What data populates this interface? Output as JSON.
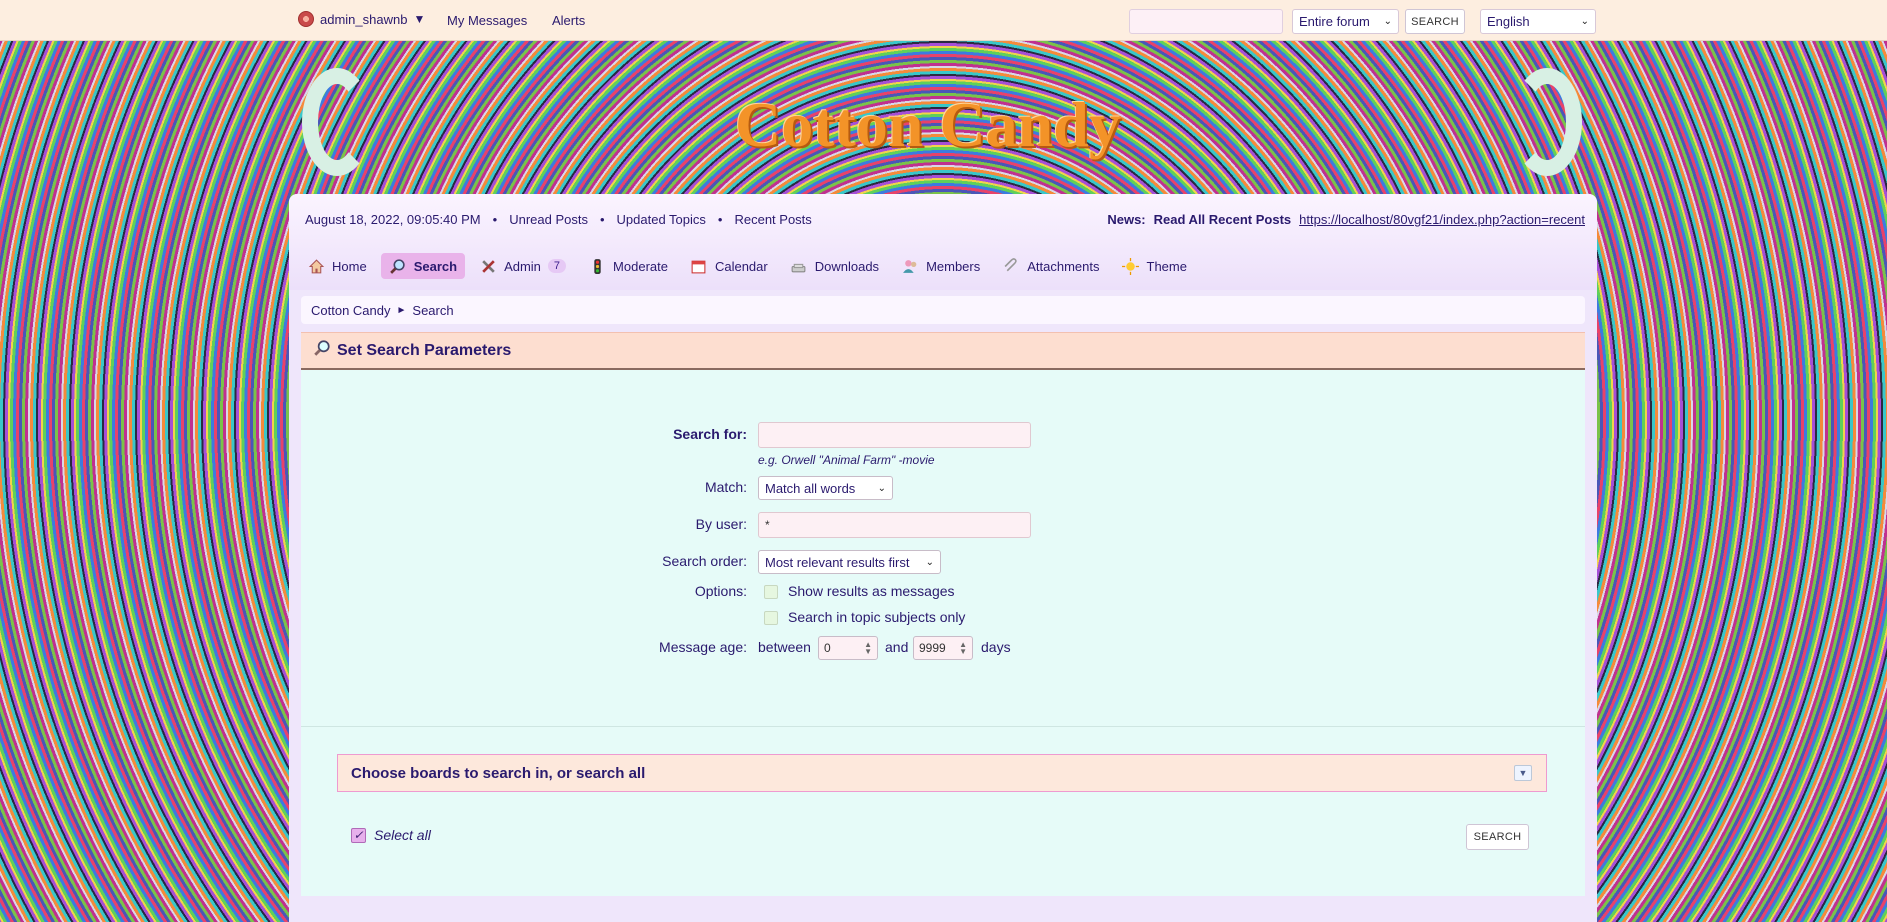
{
  "topbar": {
    "username": "admin_shawnb",
    "user_caret": "▼",
    "my_messages": "My Messages",
    "alerts": "Alerts",
    "search_placeholder": "",
    "scope_select": "Entire forum",
    "search_button": "SEARCH",
    "language_select": "English"
  },
  "banner": {
    "title": "Cotton Candy"
  },
  "infobar": {
    "datetime": "August 18, 2022, 09:05:40 PM",
    "unread": "Unread Posts",
    "updated": "Updated Topics",
    "recent": "Recent Posts",
    "sep": "•",
    "news_label": "News:",
    "news_link": "Read All Recent Posts",
    "news_url": "https://localhost/80vgf21/index.php?action=recent"
  },
  "menu": {
    "items": [
      {
        "label": "Home",
        "icon": "home-icon"
      },
      {
        "label": "Search",
        "icon": "search-icon"
      },
      {
        "label": "Admin",
        "icon": "admin-icon",
        "badge": "7"
      },
      {
        "label": "Moderate",
        "icon": "moderate-icon"
      },
      {
        "label": "Calendar",
        "icon": "calendar-icon"
      },
      {
        "label": "Downloads",
        "icon": "downloads-icon"
      },
      {
        "label": "Members",
        "icon": "members-icon"
      },
      {
        "label": "Attachments",
        "icon": "attachments-icon"
      },
      {
        "label": "Theme",
        "icon": "theme-icon"
      }
    ]
  },
  "breadcrumb": {
    "root": "Cotton Candy",
    "arrow": "►",
    "current": "Search"
  },
  "page": {
    "title": "Set Search Parameters"
  },
  "form": {
    "search_for_label": "Search for:",
    "search_for_value": "",
    "search_hint": "e.g. Orwell \"Animal Farm\" -movie",
    "match_label": "Match:",
    "match_value": "Match all words",
    "by_user_label": "By user:",
    "by_user_value": "*",
    "order_label": "Search order:",
    "order_value": "Most relevant results first",
    "options_label": "Options:",
    "option1": "Show results as messages",
    "option2": "Search in topic subjects only",
    "age_label": "Message age:",
    "between": "between",
    "min_age": "0",
    "and": "and",
    "max_age": "9999",
    "days": "days"
  },
  "boards": {
    "title": "Choose boards to search in, or search all",
    "toggle": "▼",
    "select_all": "Select all",
    "checkmark": "✓",
    "search_button": "SEARCH"
  }
}
